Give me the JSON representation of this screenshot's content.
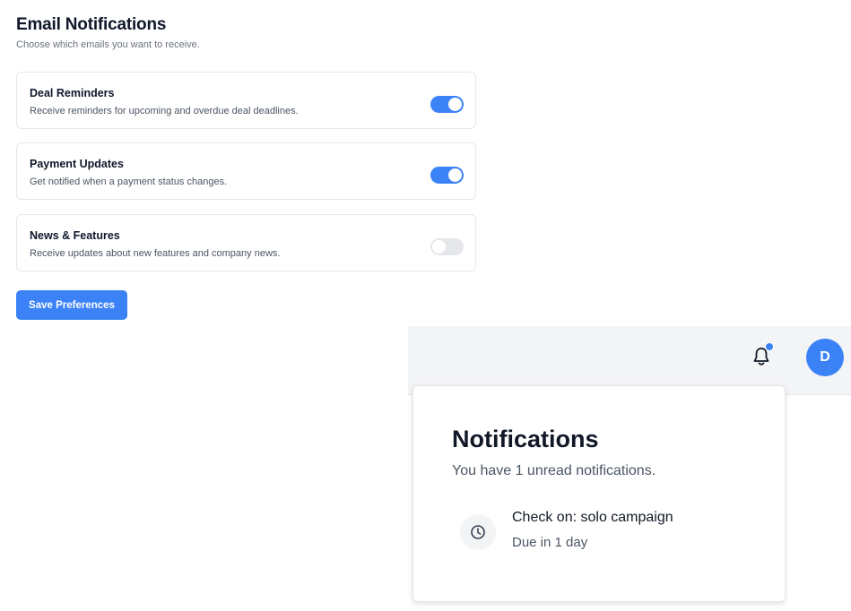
{
  "email_notifications": {
    "title": "Email Notifications",
    "subtitle": "Choose which emails you want to receive.",
    "options": [
      {
        "title": "Deal Reminders",
        "description": "Receive reminders for upcoming and overdue deal deadlines.",
        "enabled": true
      },
      {
        "title": "Payment Updates",
        "description": "Get notified when a payment status changes.",
        "enabled": true
      },
      {
        "title": "News & Features",
        "description": "Receive updates about new features and company news.",
        "enabled": false
      }
    ],
    "save_label": "Save Preferences"
  },
  "header": {
    "bell_icon": "bell-icon",
    "has_unread_dot": true,
    "avatar_initial": "D"
  },
  "notifications_panel": {
    "title": "Notifications",
    "subtitle": "You have 1 unread notifications.",
    "items": [
      {
        "icon": "clock-icon",
        "title": "Check on: solo campaign",
        "meta": "Due in 1 day"
      }
    ]
  },
  "colors": {
    "accent": "#3b82f6",
    "toggle_off": "#e5e7eb",
    "topbar_bg": "#f3f4f6"
  }
}
